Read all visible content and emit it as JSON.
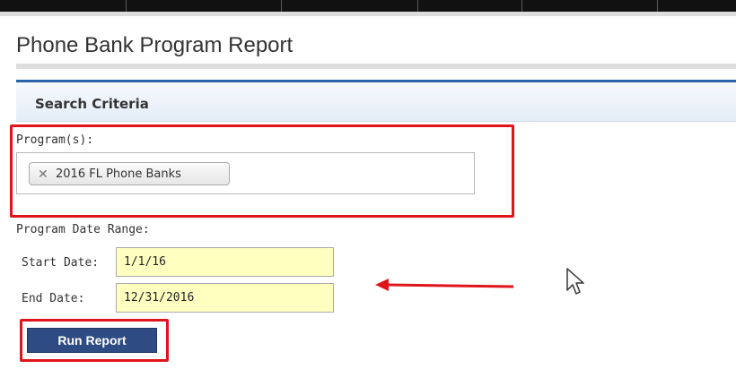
{
  "page": {
    "title": "Phone Bank Program Report"
  },
  "search_criteria": {
    "header": "Search Criteria",
    "program_label": "Program(s):",
    "program_tags": [
      "2016 FL Phone Banks"
    ],
    "date_range_label": "Program Date Range:",
    "start_date_label": "Start Date:",
    "start_date_value": "1/1/16",
    "end_date_label": "End Date:",
    "end_date_value": "12/31/2016",
    "run_button_label": "Run Report"
  },
  "colors": {
    "highlight": "#e0151c",
    "button": "#2e4b83",
    "date_field": "#ffffc0",
    "header_accent": "#2a62a8"
  },
  "icons": {
    "tag_remove": "close-icon",
    "cursor": "mouse-cursor-icon",
    "annotation": "arrow-left-icon"
  }
}
